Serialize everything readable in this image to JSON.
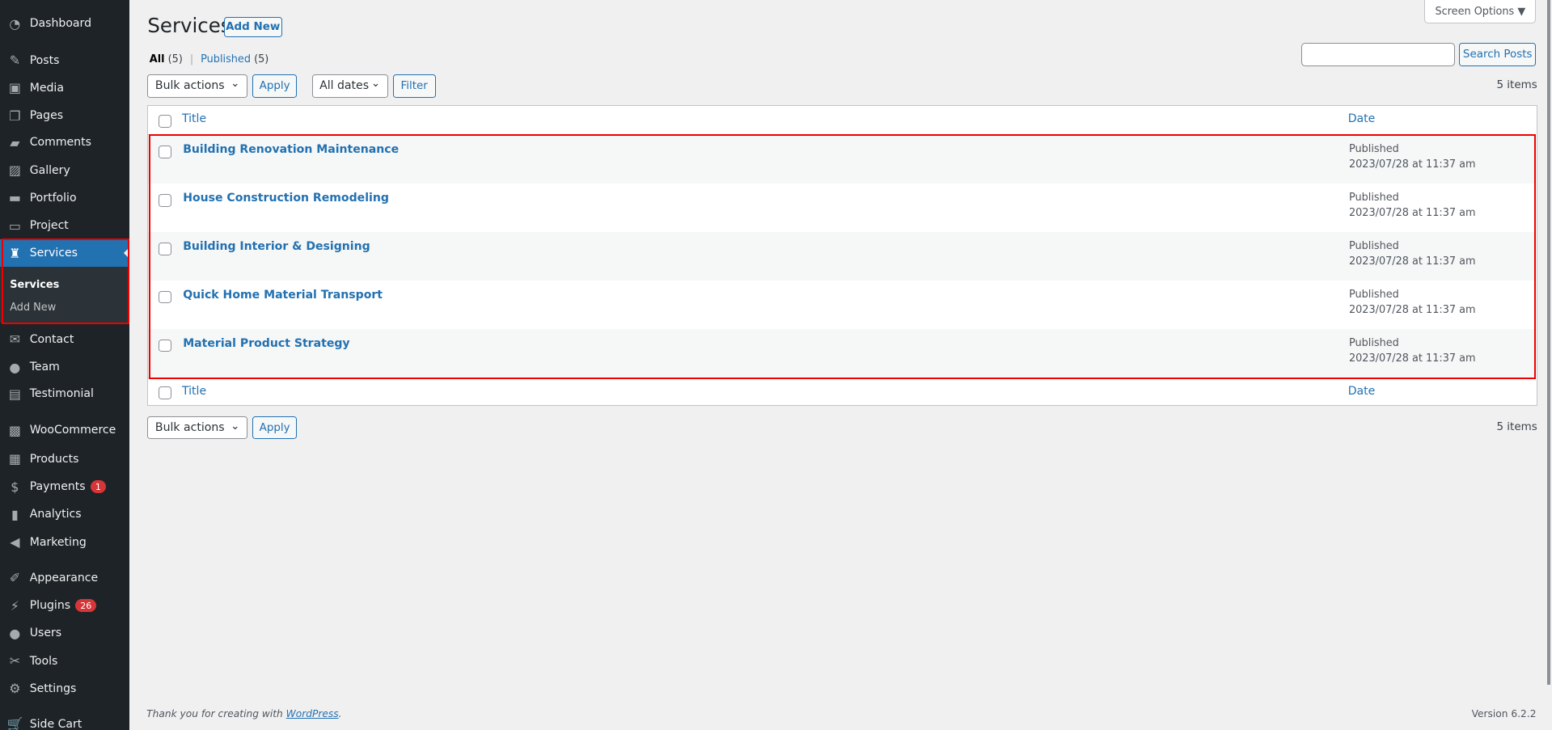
{
  "sidebar": {
    "items": [
      {
        "label": "Dashboard",
        "icon": "dashboard-icon",
        "glyph": "◔"
      },
      {
        "label": "Posts",
        "icon": "pin-icon",
        "glyph": "✎"
      },
      {
        "label": "Media",
        "icon": "media-icon",
        "glyph": "▣"
      },
      {
        "label": "Pages",
        "icon": "pages-icon",
        "glyph": "❐"
      },
      {
        "label": "Comments",
        "icon": "comment-icon",
        "glyph": "▰"
      },
      {
        "label": "Gallery",
        "icon": "gallery-icon",
        "glyph": "▨"
      },
      {
        "label": "Portfolio",
        "icon": "folder-icon",
        "glyph": "▬"
      },
      {
        "label": "Project",
        "icon": "desktop-icon",
        "glyph": "▭"
      },
      {
        "label": "Services",
        "icon": "services-icon",
        "glyph": "♜"
      },
      {
        "label": "Contact",
        "icon": "email-icon",
        "glyph": "✉"
      },
      {
        "label": "Team",
        "icon": "person-icon",
        "glyph": "●"
      },
      {
        "label": "Testimonial",
        "icon": "testimonial-icon",
        "glyph": "▤"
      },
      {
        "label": "WooCommerce",
        "icon": "woo-icon",
        "glyph": "▩"
      },
      {
        "label": "Products",
        "icon": "archive-icon",
        "glyph": "▦"
      },
      {
        "label": "Payments",
        "icon": "dollar-icon",
        "glyph": "$",
        "badge": "1"
      },
      {
        "label": "Analytics",
        "icon": "bar-chart-icon",
        "glyph": "▮"
      },
      {
        "label": "Marketing",
        "icon": "megaphone-icon",
        "glyph": "◀"
      },
      {
        "label": "Appearance",
        "icon": "brush-icon",
        "glyph": "✐"
      },
      {
        "label": "Plugins",
        "icon": "plugin-icon",
        "glyph": "⚡",
        "badge": "26"
      },
      {
        "label": "Users",
        "icon": "users-icon",
        "glyph": "●"
      },
      {
        "label": "Tools",
        "icon": "wrench-icon",
        "glyph": "✂"
      },
      {
        "label": "Settings",
        "icon": "settings-icon",
        "glyph": "⚙"
      },
      {
        "label": "Side Cart",
        "icon": "cart-icon",
        "glyph": "🛒"
      }
    ],
    "submenu": {
      "current": "Services",
      "add_new": "Add New"
    }
  },
  "header": {
    "title": "Services",
    "add_new": "Add New",
    "screen_options": "Screen Options ▼"
  },
  "filters": {
    "all": "All",
    "all_count": "(5)",
    "sep": "|",
    "published": "Published",
    "published_count": "(5)"
  },
  "search": {
    "value": "",
    "button": "Search Posts"
  },
  "tablenav": {
    "bulk": "Bulk actions",
    "apply": "Apply",
    "dates": "All dates",
    "filter": "Filter",
    "count": "5 items"
  },
  "table": {
    "columns": {
      "title": "Title",
      "date": "Date"
    },
    "rows": [
      {
        "title": "Building Renovation Maintenance",
        "status": "Published",
        "date": "2023/07/28 at 11:37 am"
      },
      {
        "title": "House Construction Remodeling",
        "status": "Published",
        "date": "2023/07/28 at 11:37 am"
      },
      {
        "title": "Building Interior & Designing",
        "status": "Published",
        "date": "2023/07/28 at 11:37 am"
      },
      {
        "title": "Quick Home Material Transport",
        "status": "Published",
        "date": "2023/07/28 at 11:37 am"
      },
      {
        "title": "Material Product Strategy",
        "status": "Published",
        "date": "2023/07/28 at 11:37 am"
      }
    ]
  },
  "footer": {
    "thanks": "Thank you for creating with ",
    "wp": "WordPress",
    "dot": ".",
    "version": "Version 6.2.2"
  },
  "colors": {
    "accent": "#2271b1",
    "sidebar": "#1d2327",
    "highlight": "#e00000"
  }
}
